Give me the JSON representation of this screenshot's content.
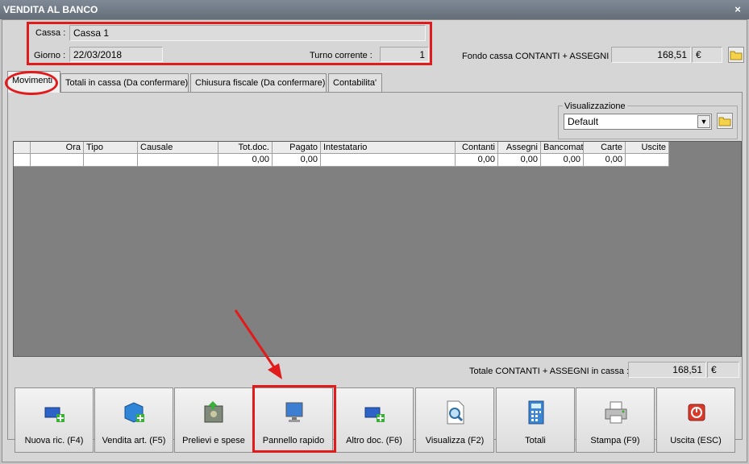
{
  "window": {
    "title": "VENDITA AL BANCO",
    "close": "×"
  },
  "header": {
    "cassa_label": "Cassa :",
    "cassa_value": "Cassa 1",
    "giorno_label": "Giorno :",
    "giorno_value": "22/03/2018",
    "turno_label": "Turno corrente :",
    "turno_value": "1",
    "fondo_label": "Fondo cassa CONTANTI + ASSEGNI :",
    "fondo_value": "168,51",
    "fondo_currency": "€"
  },
  "tabs": [
    {
      "label": "Movimenti"
    },
    {
      "label": "Totali in cassa (Da confermare)"
    },
    {
      "label": "Chiusura fiscale (Da confermare)"
    },
    {
      "label": "Contabilita'"
    }
  ],
  "view": {
    "group_label": "Visualizzazione",
    "selected": "Default"
  },
  "grid": {
    "columns": [
      "",
      "Ora",
      "Tipo",
      "Causale",
      "Tot.doc.",
      "Pagato",
      "Intestatario",
      "Contanti",
      "Assegni",
      "Bancomat",
      "Carte",
      "Uscite"
    ],
    "rows": [
      [
        "",
        "",
        "",
        "",
        "0,00",
        "0,00",
        "",
        "0,00",
        "0,00",
        "0,00",
        "0,00",
        ""
      ]
    ]
  },
  "totale": {
    "label": "Totale CONTANTI + ASSEGNI in cassa :",
    "value": "168,51",
    "currency": "€"
  },
  "buttons": [
    {
      "label": "Nuova ric. (F4)",
      "icon": "monitor-plus-icon"
    },
    {
      "label": "Vendita art. (F5)",
      "icon": "box-plus-icon"
    },
    {
      "label": "Prelievi e spese",
      "icon": "safe-icon"
    },
    {
      "label": "Pannello rapido",
      "icon": "monitor-icon"
    },
    {
      "label": "Altro doc. (F6)",
      "icon": "monitor-plus-icon"
    },
    {
      "label": "Visualizza (F2)",
      "icon": "document-search-icon"
    },
    {
      "label": "Totali",
      "icon": "calculator-icon"
    },
    {
      "label": "Stampa (F9)",
      "icon": "printer-icon"
    },
    {
      "label": "Uscita (ESC)",
      "icon": "power-icon"
    }
  ],
  "colors": {
    "highlight": "#e11b1b",
    "grid_bg": "#808080",
    "title_bar": "#6b7580"
  }
}
